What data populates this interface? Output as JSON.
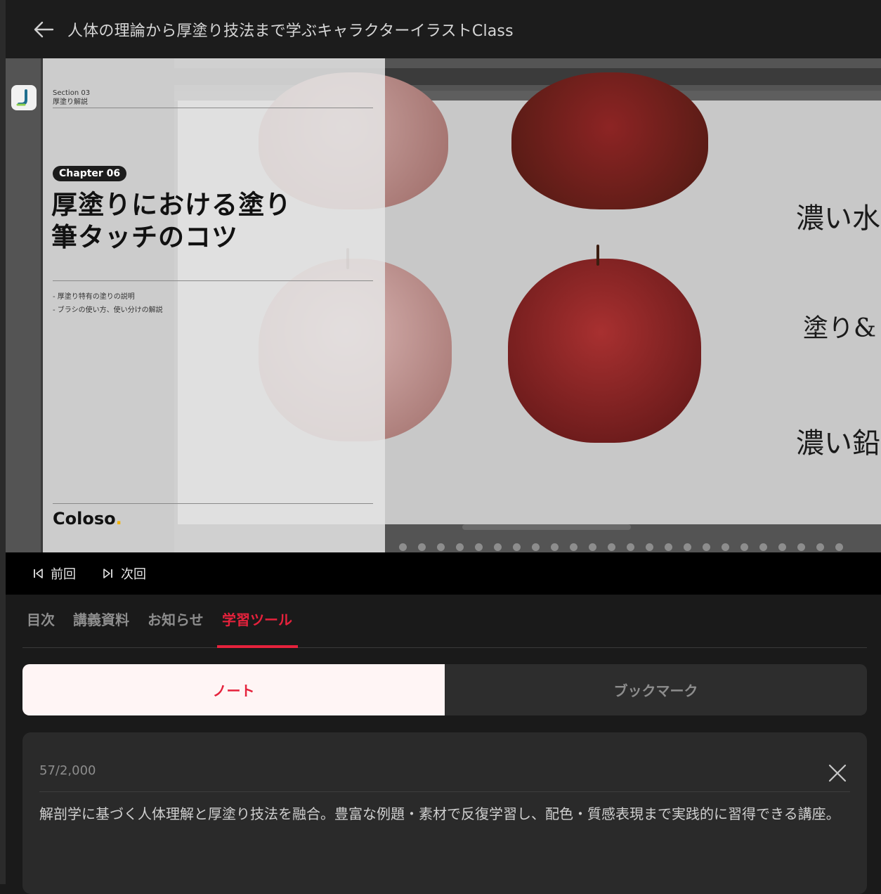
{
  "header": {
    "title": "人体の理論から厚塗り技法まで学ぶキャラクターイラストClass"
  },
  "video": {
    "slide": {
      "section_label": "Section 03",
      "section_name": "厚塗り解説",
      "chapter": "Chapter 06",
      "title_line1": "厚塗りにおける塗り",
      "title_line2": "筆タッチのコツ",
      "bullets": [
        "- 厚塗り特有の塗りの説明",
        "- ブラシの使い方、使い分けの解説"
      ],
      "brand": "Coloso",
      "brand_dot": "."
    },
    "handwriting": [
      "濃い水",
      "塗り&",
      "濃い鉛"
    ]
  },
  "controls": {
    "prev_label": "前回",
    "next_label": "次回"
  },
  "tabs": [
    {
      "label": "目次",
      "active": false
    },
    {
      "label": "講義資料",
      "active": false
    },
    {
      "label": "お知らせ",
      "active": false
    },
    {
      "label": "学習ツール",
      "active": true
    }
  ],
  "segment": {
    "note_label": "ノート",
    "bookmark_label": "ブックマーク"
  },
  "note": {
    "counter": "57/2,000",
    "text": "解剖学に基づく人体理解と厚塗り技法を融合。豊富な例題・素材で反復学習し、配色・質感表現まで実践的に習得できる講座。"
  },
  "colors": {
    "accent": "#e5223c",
    "background": "#1a1a1a"
  },
  "icons": [
    "back-arrow-icon",
    "skip-previous-icon",
    "skip-next-icon",
    "close-icon"
  ]
}
